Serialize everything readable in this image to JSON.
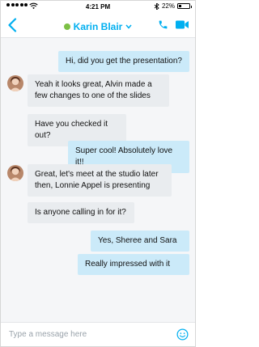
{
  "status_bar": {
    "time": "4:21 PM",
    "battery": "22%",
    "battery_level": 0.22
  },
  "header": {
    "contact_name": "Karin Blair",
    "accent_color": "#00aff0",
    "presence_color": "#7cc045"
  },
  "messages": [
    {
      "direction": "sent",
      "text": "Hi, did you get the presentation?"
    },
    {
      "direction": "received",
      "text": "Yeah it looks great, Alvin made a few changes to one of the slides"
    },
    {
      "direction": "received",
      "text": "Have you checked it out?"
    },
    {
      "direction": "sent",
      "text": "Super cool! Absolutely love it!!"
    },
    {
      "direction": "received",
      "text": "Great, let's meet at the studio later then, Lonnie Appel is presenting"
    },
    {
      "direction": "received",
      "text": "Is anyone calling in for it?"
    },
    {
      "direction": "sent",
      "text": "Yes, Sheree and Sara"
    },
    {
      "direction": "sent",
      "text": "Really impressed with it"
    }
  ],
  "composer": {
    "placeholder": "Type a message here"
  },
  "icons": {
    "back": "chevron-left-icon",
    "call": "phone-icon",
    "video": "video-camera-icon",
    "emoji": "emoji-icon"
  }
}
